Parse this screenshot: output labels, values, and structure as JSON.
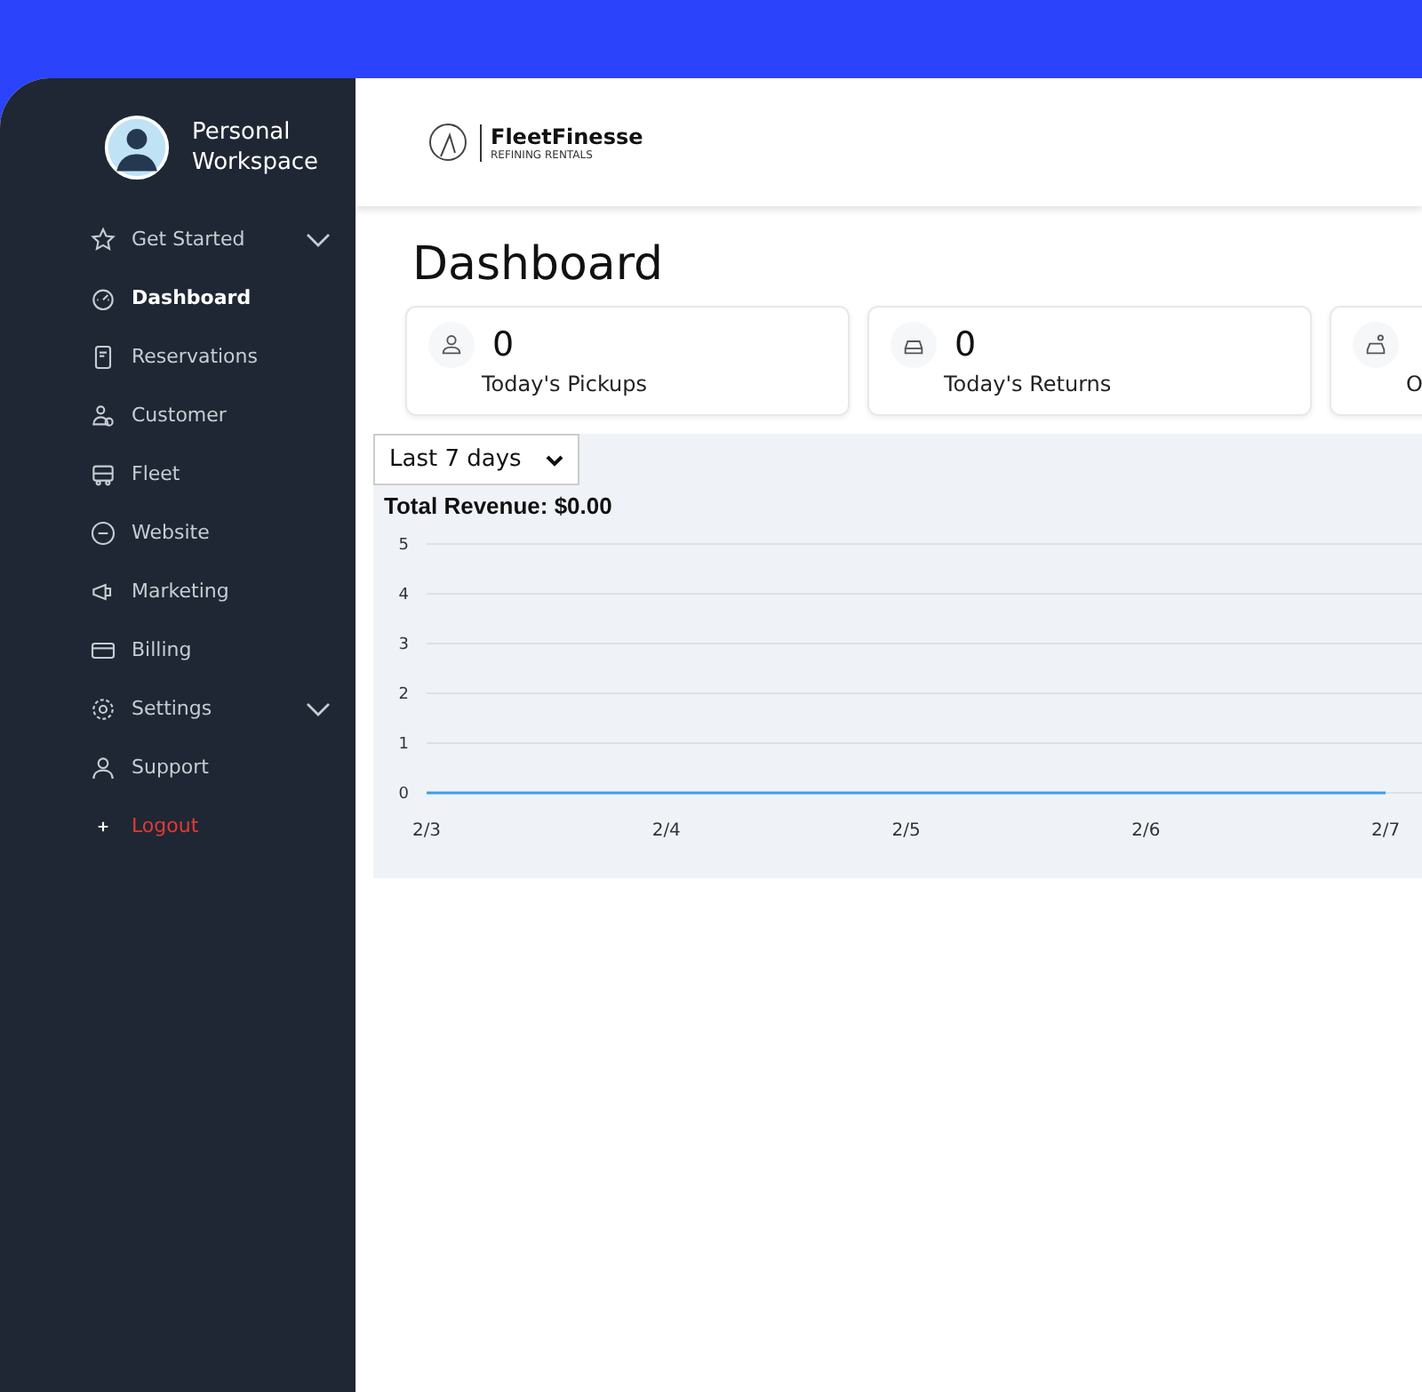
{
  "sidebar": {
    "workspace": "Personal Workspace",
    "items": [
      {
        "label": "Get Started",
        "selected": false,
        "expanded": false,
        "kind": "link"
      },
      {
        "label": "Dashboard",
        "selected": true,
        "kind": "link"
      },
      {
        "label": "Reservations",
        "selected": false,
        "kind": "link"
      },
      {
        "label": "Customer",
        "selected": false,
        "kind": "link"
      },
      {
        "label": "Fleet",
        "selected": false,
        "kind": "link"
      },
      {
        "label": "Website",
        "selected": false,
        "kind": "link"
      },
      {
        "label": "Marketing",
        "selected": false,
        "kind": "link"
      },
      {
        "label": "Billing",
        "selected": false,
        "kind": "link"
      },
      {
        "label": "Settings",
        "selected": false,
        "expanded": false,
        "kind": "link"
      },
      {
        "label": "Support",
        "selected": false,
        "kind": "link"
      },
      {
        "label": "Logout",
        "selected": false,
        "kind": "logout"
      }
    ]
  },
  "header": {
    "brand": "FleetFinesse",
    "tagline": "REFINING RENTALS"
  },
  "page_title": "Dashboard",
  "stats": [
    {
      "value": "0",
      "label": "Today's Pickups"
    },
    {
      "value": "0",
      "label": "Today's Returns"
    },
    {
      "label": "O"
    }
  ],
  "range_select": {
    "value": "Last 7 days"
  },
  "revenue": {
    "label": "Total Revenue: $0.00",
    "chart_data": {
      "type": "line",
      "grid": true,
      "categories": [
        "2/3",
        "2/4",
        "2/5",
        "2/6",
        "2/7"
      ],
      "ylim": [
        0,
        5
      ],
      "yticks": [
        0,
        1,
        2,
        3,
        4,
        5
      ],
      "series": [
        {
          "color": "#3b9ee8",
          "values": [
            0,
            0,
            0,
            0,
            0
          ]
        }
      ]
    }
  }
}
